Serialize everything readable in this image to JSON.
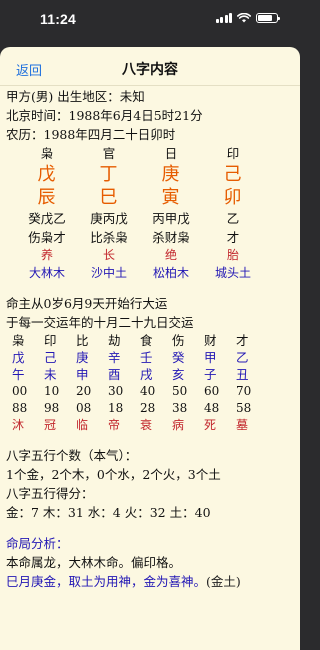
{
  "status": {
    "time": "11:24",
    "icons": [
      "cellular-signal-icon",
      "wifi-icon",
      "battery-icon"
    ]
  },
  "nav": {
    "back_label": "返回",
    "title": "八字内容"
  },
  "info": {
    "line1": "甲方(男) 出生地区：未知",
    "line2": "北京时间：1988年6月4日5时21分",
    "line3": "农历：1988年四月二十日卯时"
  },
  "pillars": {
    "gods": [
      "枭",
      "官",
      "日",
      "印"
    ],
    "stems": [
      "戊",
      "丁",
      "庚",
      "己"
    ],
    "branches": [
      "辰",
      "巳",
      "寅",
      "卯"
    ],
    "hidden": [
      "癸戊乙",
      "庚丙戊",
      "丙甲戊",
      "乙"
    ],
    "hidden_gods": [
      "伤枭才",
      "比杀枭",
      "杀财枭",
      "才"
    ],
    "stages": [
      "养",
      "长",
      "绝",
      "胎"
    ],
    "nayin": [
      "大林木",
      "沙中土",
      "松柏木",
      "城头土"
    ]
  },
  "luck": {
    "line1": "命主从0岁6月9天开始行大运",
    "line2": "于每一交运年的十月二十九日交运",
    "gods": [
      "枭",
      "印",
      "比",
      "劫",
      "食",
      "伤",
      "财",
      "才"
    ],
    "stems": [
      "戊",
      "己",
      "庚",
      "辛",
      "壬",
      "癸",
      "甲",
      "乙"
    ],
    "branches": [
      "午",
      "未",
      "申",
      "酉",
      "戌",
      "亥",
      "子",
      "丑"
    ],
    "ages": [
      "00",
      "10",
      "20",
      "30",
      "40",
      "50",
      "60",
      "70"
    ],
    "years": [
      "88",
      "98",
      "08",
      "18",
      "28",
      "38",
      "48",
      "58"
    ],
    "stages": [
      "沐",
      "冠",
      "临",
      "帝",
      "衰",
      "病",
      "死",
      "墓"
    ]
  },
  "elements": {
    "count_title": "八字五行个数（本气）：",
    "counts": "1个金，2个木，0个水，2个火，3个土",
    "score_title": "八字五行得分：",
    "scores": "金：7 木：31 水：4 火：32 土：40"
  },
  "analysis": {
    "title": "命局分析：",
    "line1": "本命属龙，大林木命。偏印格。",
    "line2_blue": "巳月庚金，取土为用神，金为喜神。",
    "line2_tail": "(金土)"
  },
  "colors": {
    "background": "#fcf8e1",
    "orange": "#e65c00",
    "blue": "#2318b5",
    "red": "#c2272d",
    "link": "#1d6fde"
  }
}
